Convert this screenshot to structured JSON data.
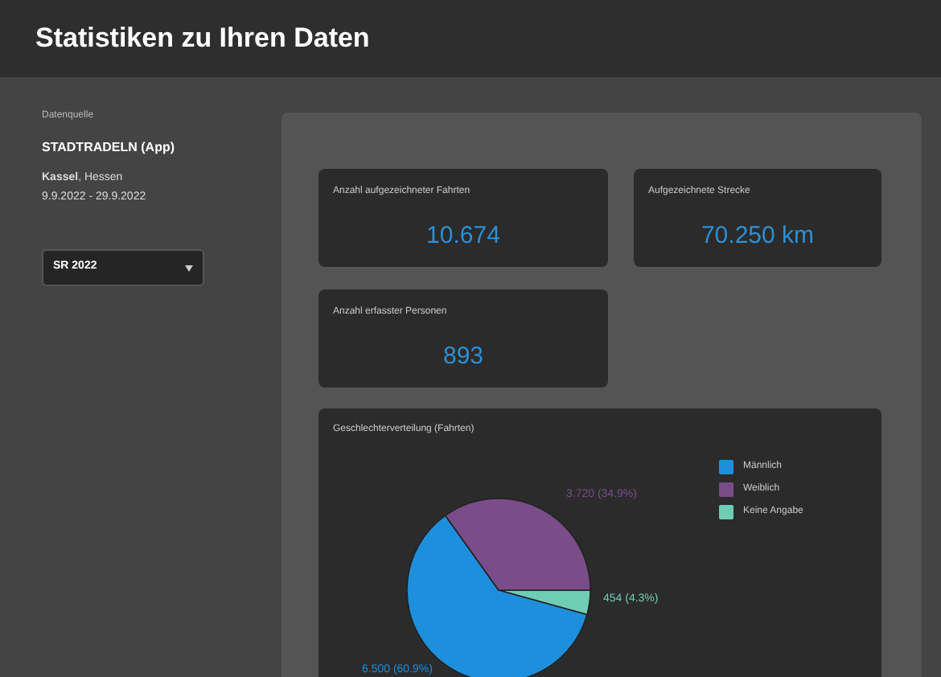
{
  "header": {
    "title": "Statistiken zu Ihren Daten"
  },
  "sidebar": {
    "source_label": "Datenquelle",
    "source": "STADTRADELN (App)",
    "location_bold": "Kassel",
    "location_rest": ", Hessen",
    "period": "9.9.2022 - 29.9.2022",
    "select": {
      "value": "SR 2022"
    }
  },
  "stats": [
    {
      "label": "Anzahl aufgezeichneter Fahrten",
      "value": "10.674"
    },
    {
      "label": "Aufgezeichnete Strecke",
      "value": "70.250 km"
    },
    {
      "label": "Anzahl erfasster Personen",
      "value": "893"
    }
  ],
  "gender_chart": {
    "title": "Geschlechterverteilung (Fahrten)",
    "chart_data": {
      "type": "pie",
      "categories": [
        "Männlich",
        "Weiblich",
        "Keine Angabe"
      ],
      "values": [
        60.9,
        34.9,
        4.3
      ],
      "colors": [
        "#1e8fdc",
        "#7a4d8a",
        "#6fcdb4"
      ],
      "value_labels": [
        "6.500 (60.9%)",
        "3.720 (34.9%)",
        "454 (4.3%)"
      ]
    }
  }
}
